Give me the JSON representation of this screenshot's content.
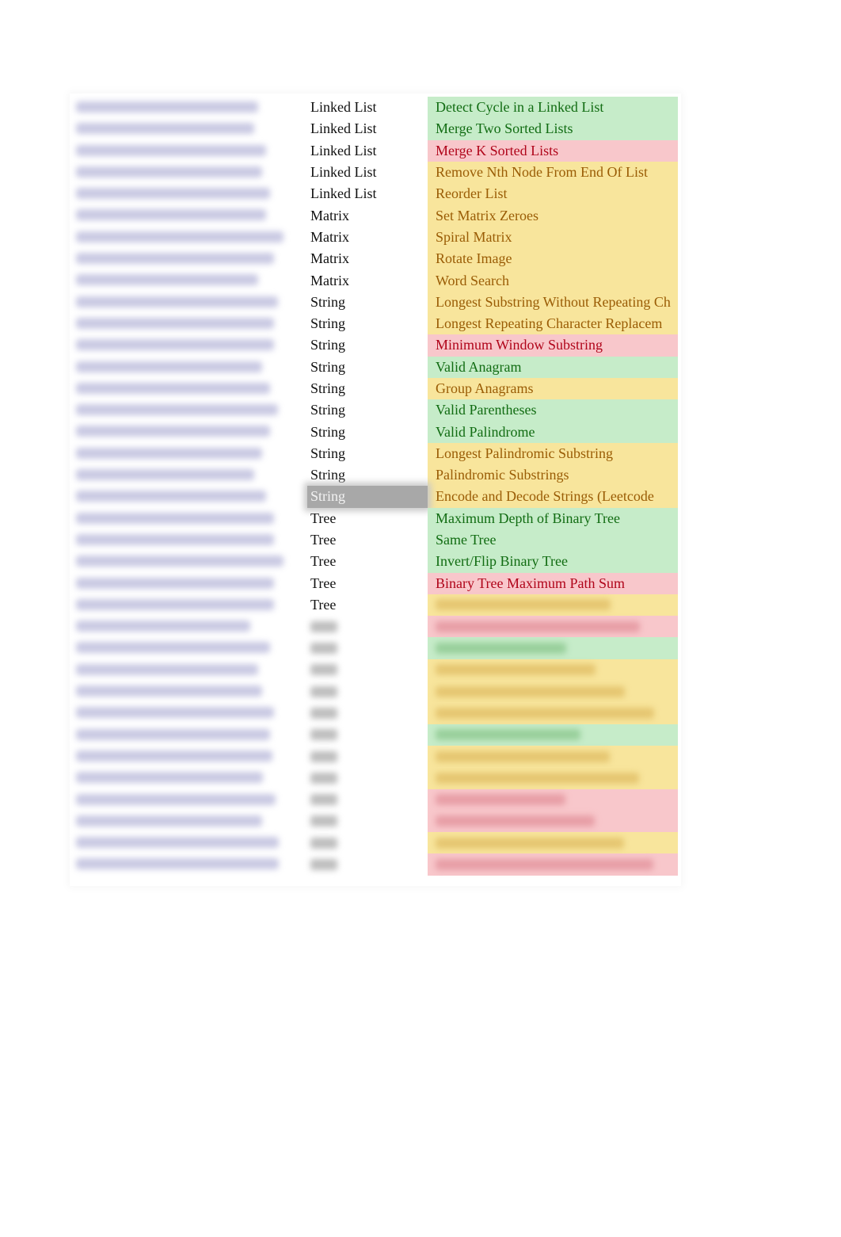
{
  "colors": {
    "easy_bg": "#c6ecc9",
    "easy_text": "#116c12",
    "hard_bg": "#f8c7cb",
    "hard_text": "#b0051a",
    "medium_bg": "#f8e59c",
    "medium_text": "#9a5c05",
    "selected_cell_bg": "#a8a8a8"
  },
  "rows": [
    {
      "topic": "Linked List",
      "title": "Detect Cycle in a Linked List",
      "difficulty": "green"
    },
    {
      "topic": "Linked List",
      "title": "Merge Two Sorted Lists",
      "difficulty": "green"
    },
    {
      "topic": "Linked List",
      "title": "Merge K Sorted Lists",
      "difficulty": "red"
    },
    {
      "topic": "Linked List",
      "title": "Remove Nth Node From End Of List",
      "difficulty": "yellow"
    },
    {
      "topic": "Linked List",
      "title": "Reorder List",
      "difficulty": "yellow"
    },
    {
      "topic": "Matrix",
      "title": "Set Matrix Zeroes",
      "difficulty": "yellow"
    },
    {
      "topic": "Matrix",
      "title": "Spiral Matrix",
      "difficulty": "yellow"
    },
    {
      "topic": "Matrix",
      "title": "Rotate Image",
      "difficulty": "yellow"
    },
    {
      "topic": "Matrix",
      "title": "Word Search",
      "difficulty": "yellow"
    },
    {
      "topic": "String",
      "title": "Longest Substring Without Repeating Ch",
      "difficulty": "yellow"
    },
    {
      "topic": "String",
      "title": "Longest Repeating Character Replacem",
      "difficulty": "yellow"
    },
    {
      "topic": "String",
      "title": "Minimum Window Substring",
      "difficulty": "red"
    },
    {
      "topic": "String",
      "title": "Valid Anagram",
      "difficulty": "green"
    },
    {
      "topic": "String",
      "title": "Group Anagrams",
      "difficulty": "yellow"
    },
    {
      "topic": "String",
      "title": "Valid Parentheses",
      "difficulty": "green"
    },
    {
      "topic": "String",
      "title": "Valid Palindrome",
      "difficulty": "green"
    },
    {
      "topic": "String",
      "title": "Longest Palindromic Substring",
      "difficulty": "yellow"
    },
    {
      "topic": "String",
      "title": "Palindromic Substrings",
      "difficulty": "yellow"
    },
    {
      "topic": "String",
      "title": "Encode and Decode Strings (Leetcode",
      "difficulty": "yellow",
      "selected": true
    },
    {
      "topic": "Tree",
      "title": "Maximum Depth of Binary Tree",
      "difficulty": "green"
    },
    {
      "topic": "Tree",
      "title": "Same Tree",
      "difficulty": "green"
    },
    {
      "topic": "Tree",
      "title": "Invert/Flip Binary Tree",
      "difficulty": "green"
    },
    {
      "topic": "Tree",
      "title": "Binary Tree Maximum Path Sum",
      "difficulty": "red"
    },
    {
      "topic": "Tree",
      "title": null,
      "difficulty": "yellow"
    },
    {
      "topic": null,
      "title": null,
      "difficulty": "red"
    },
    {
      "topic": null,
      "title": null,
      "difficulty": "green"
    },
    {
      "topic": null,
      "title": null,
      "difficulty": "yellow"
    },
    {
      "topic": null,
      "title": null,
      "difficulty": "yellow"
    },
    {
      "topic": null,
      "title": null,
      "difficulty": "yellow"
    },
    {
      "topic": null,
      "title": null,
      "difficulty": "green"
    },
    {
      "topic": null,
      "title": null,
      "difficulty": "yellow"
    },
    {
      "topic": null,
      "title": null,
      "difficulty": "yellow"
    },
    {
      "topic": null,
      "title": null,
      "difficulty": "red"
    },
    {
      "topic": null,
      "title": null,
      "difficulty": "red"
    },
    {
      "topic": null,
      "title": null,
      "difficulty": "yellow"
    },
    {
      "topic": null,
      "title": null,
      "difficulty": "red"
    }
  ]
}
